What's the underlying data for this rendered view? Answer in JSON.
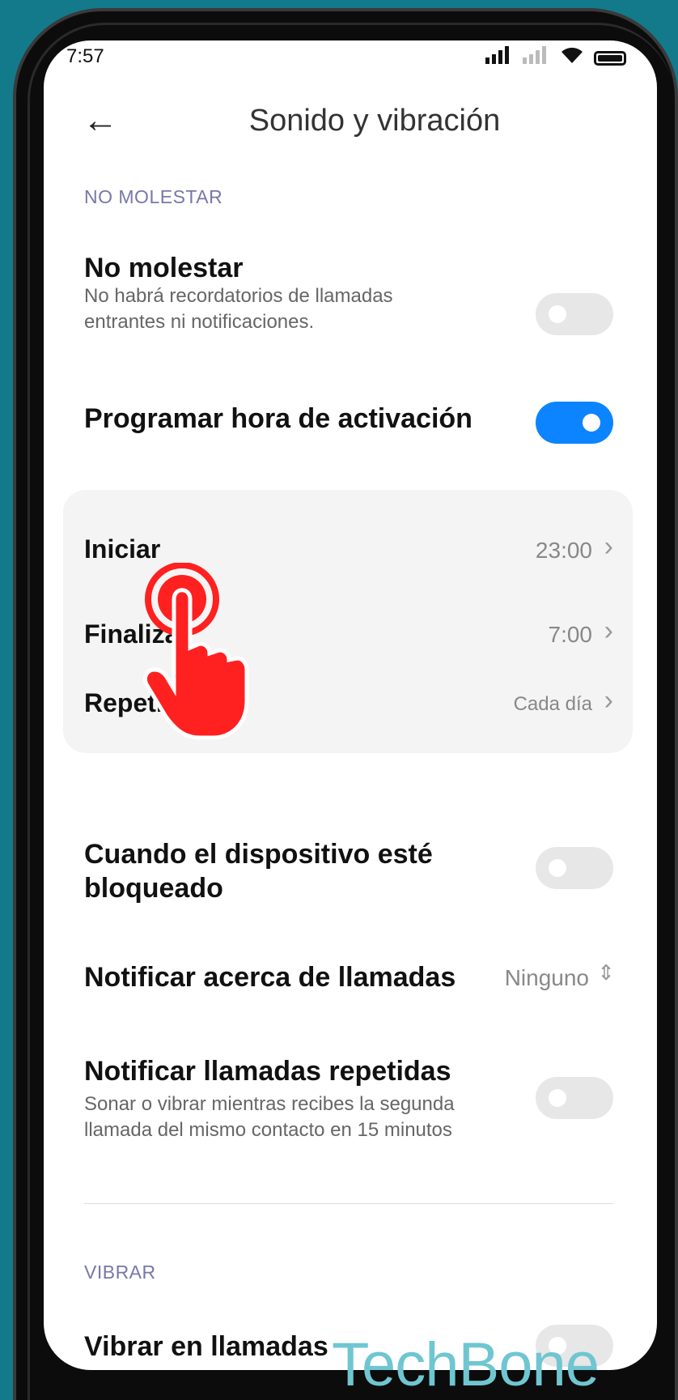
{
  "status": {
    "time": "7:57"
  },
  "header": {
    "title": "Sonido y vibración"
  },
  "sections": {
    "dnd_label": "NO MOLESTAR",
    "vibrate_label": "VIBRAR"
  },
  "dnd": {
    "title": "No molestar",
    "subtitle": "No habrá recordatorios de llamadas entrantes ni notificaciones.",
    "enabled": false
  },
  "schedule": {
    "title": "Programar hora de activación",
    "enabled": true
  },
  "schedule_group": {
    "start_label": "Iniciar",
    "start_value": "23:00",
    "end_label": "Finalizar",
    "end_value": "7:00",
    "repeat_label": "Repetir",
    "repeat_value": "Cada día"
  },
  "locked": {
    "title": "Cuando el dispositivo esté bloqueado",
    "enabled": false
  },
  "notify_calls": {
    "title": "Notificar acerca de llamadas",
    "value": "Ninguno"
  },
  "repeat_calls": {
    "title": "Notificar llamadas repetidas",
    "subtitle": "Sonar o vibrar mientras recibes la segunda llamada del mismo contacto en 15 minutos",
    "enabled": false
  },
  "vibrate_calls": {
    "title": "Vibrar en llamadas"
  },
  "watermark": "TechBone",
  "colors": {
    "accent": "#0d84ff",
    "background": "#137a8c",
    "tap_indicator": "#ff2020"
  }
}
